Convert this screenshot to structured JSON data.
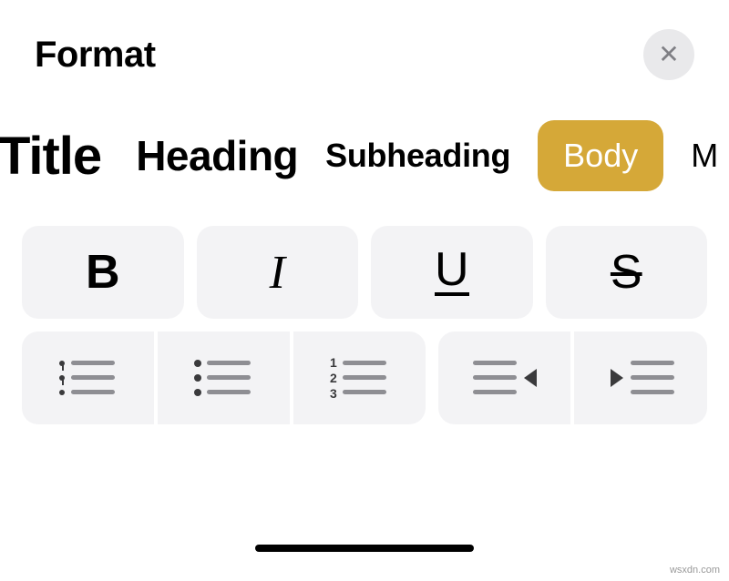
{
  "header": {
    "title": "Format"
  },
  "styles": {
    "title": "Title",
    "heading": "Heading",
    "subheading": "Subheading",
    "body": "Body",
    "monospaced": "M"
  },
  "format_buttons": {
    "bold": "B",
    "italic": "I",
    "underline": "U",
    "strikethrough": "S"
  },
  "colors": {
    "accent": "#d5a838",
    "button_bg": "#f3f3f5",
    "close_bg": "#e9e9eb"
  },
  "watermark": "wsxdn.com"
}
